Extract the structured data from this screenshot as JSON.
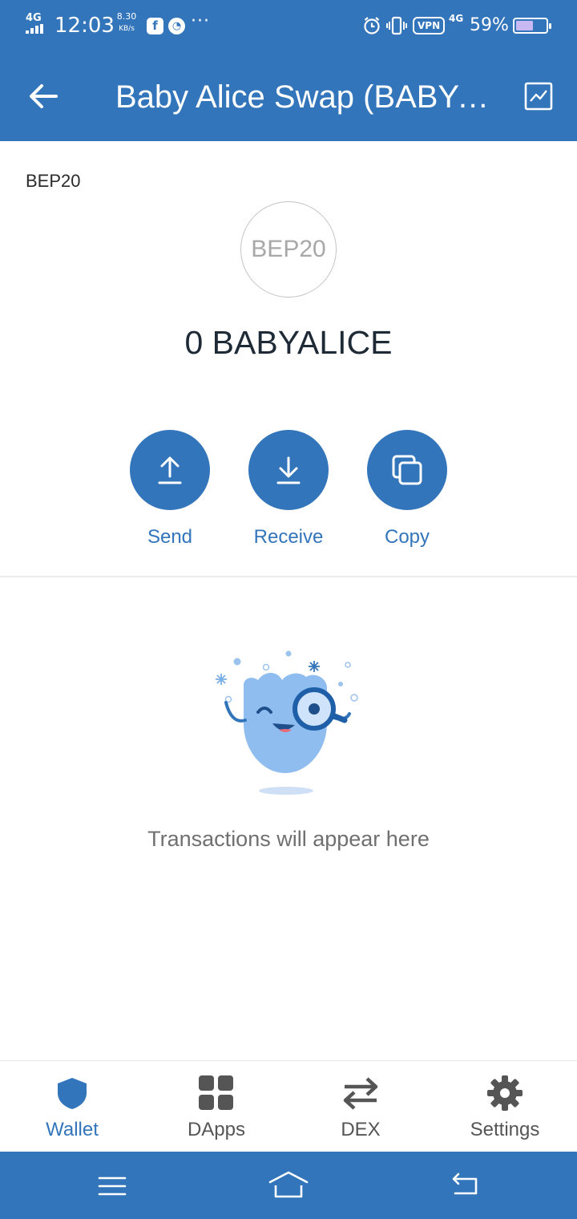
{
  "status_bar": {
    "network": "4G",
    "time": "12:03",
    "speed_value": "8.30",
    "speed_unit": "KB/s",
    "app_icon_1": "f",
    "more": "···",
    "vpn": "VPN",
    "network_2": "4G",
    "battery_percent": "59%",
    "battery_level": 0.59
  },
  "header": {
    "title": "Baby Alice Swap (BABYALICE)",
    "back_icon": "arrow-left-icon",
    "chart_icon": "price-chart-icon"
  },
  "token": {
    "chain_label": "BEP20",
    "logo_text": "BEP20",
    "balance": "0 BABYALICE"
  },
  "actions": [
    {
      "label": "Send",
      "icon": "upload-icon"
    },
    {
      "label": "Receive",
      "icon": "download-icon"
    },
    {
      "label": "Copy",
      "icon": "copy-icon"
    }
  ],
  "empty_state": {
    "illustration": "magnifier-mascot",
    "message": "Transactions will appear here"
  },
  "tabs": [
    {
      "label": "Wallet",
      "icon": "shield-icon",
      "active": true
    },
    {
      "label": "DApps",
      "icon": "grid-icon",
      "active": false
    },
    {
      "label": "DEX",
      "icon": "swap-arrows-icon",
      "active": false
    },
    {
      "label": "Settings",
      "icon": "gear-icon",
      "active": false
    }
  ],
  "colors": {
    "primary": "#3375bb",
    "text_dark": "#1f2a37",
    "text_muted": "#707070",
    "tab_inactive": "#555555"
  }
}
